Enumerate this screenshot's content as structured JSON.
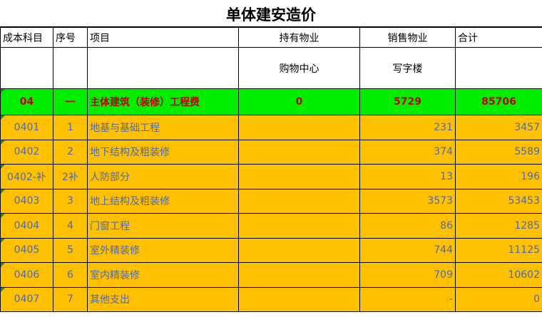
{
  "title": "单体建安造价",
  "headers": {
    "code": "成本科目",
    "seq": "序号",
    "item": "项目",
    "held": "持有物业",
    "sold": "销售物业",
    "total": "合计",
    "held_sub": "购物中心",
    "sold_sub": "写字楼"
  },
  "summary": {
    "code": "04",
    "seq": "一",
    "item": "主体建筑（装修）工程费",
    "held": "0",
    "sold": "5729",
    "total": "85706"
  },
  "rows": [
    {
      "code": "0401",
      "seq": "1",
      "item": "地基与基础工程",
      "held": "",
      "sold": "231",
      "total": "3457"
    },
    {
      "code": "0402",
      "seq": "2",
      "item": "地下结构及粗装修",
      "held": "",
      "sold": "374",
      "total": "5589"
    },
    {
      "code": "0402-补",
      "seq": "2补",
      "item": "人防部分",
      "held": "",
      "sold": "13",
      "total": "196"
    },
    {
      "code": "0403",
      "seq": "3",
      "item": "地上结构及粗装修",
      "held": "",
      "sold": "3573",
      "total": "53453"
    },
    {
      "code": "0404",
      "seq": "4",
      "item": "门窗工程",
      "held": "",
      "sold": "86",
      "total": "1285"
    },
    {
      "code": "0405",
      "seq": "5",
      "item": "室外精装修",
      "held": "",
      "sold": "744",
      "total": "11125"
    },
    {
      "code": "0406",
      "seq": "6",
      "item": "室内精装修",
      "held": "",
      "sold": "709",
      "total": "10602"
    },
    {
      "code": "0407",
      "seq": "7",
      "item": "其他支出",
      "held": "",
      "sold": "-",
      "total": "0"
    }
  ],
  "colors": {
    "summary_fill": "#00ee00",
    "summary_text": "#c00000",
    "row_fill": "#ffc000",
    "row_text": "#4f6aa8"
  }
}
